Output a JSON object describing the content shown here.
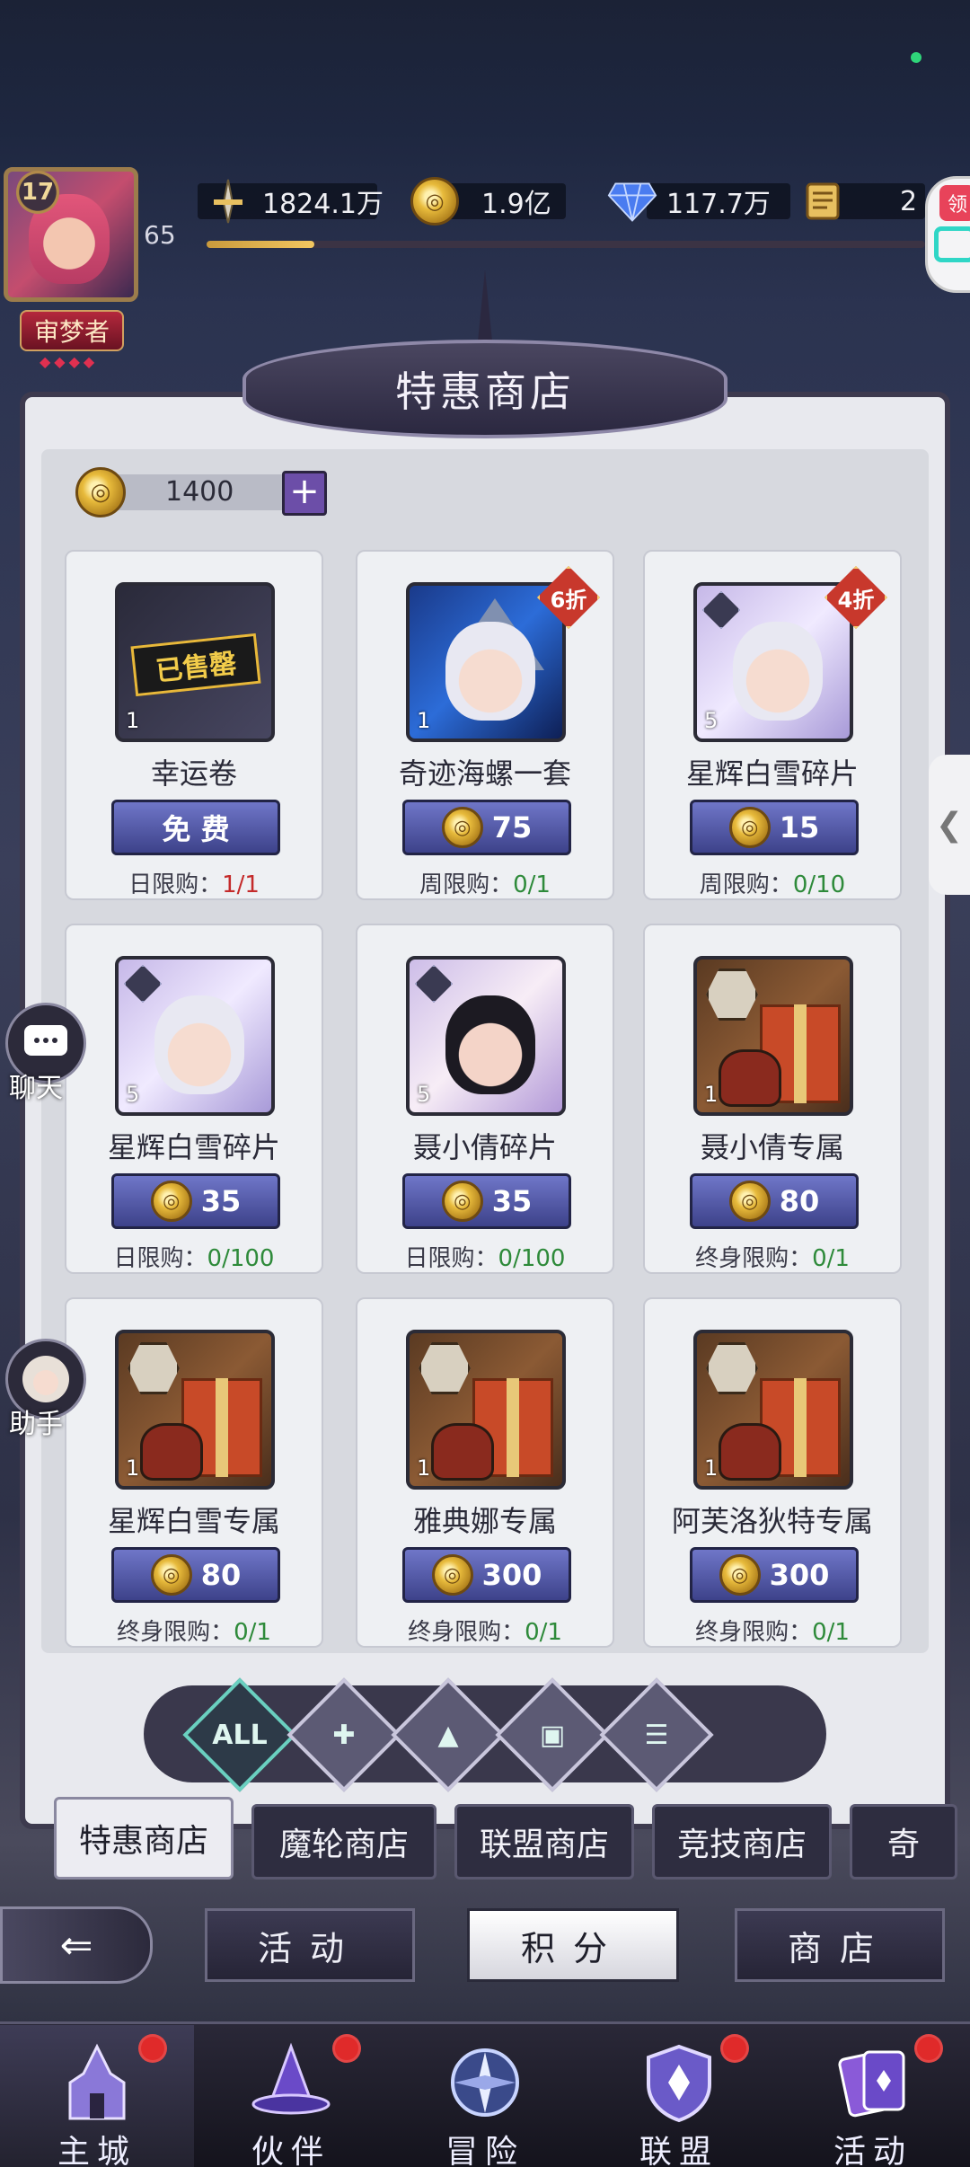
{
  "player": {
    "vip_level": "17",
    "level": "65",
    "title": "审梦者",
    "xp_fraction": 0.15
  },
  "resources": [
    {
      "name": "power",
      "icon": "sword-icon",
      "value": "1824.1万"
    },
    {
      "name": "gold",
      "icon": "gold-coin-icon",
      "value": "1.9亿"
    },
    {
      "name": "diamond",
      "icon": "diamond-icon",
      "value": "117.7万"
    },
    {
      "name": "scroll",
      "icon": "scroll-icon",
      "value": "2"
    }
  ],
  "gift_corner": {
    "tag": "领"
  },
  "shop": {
    "title": "特惠商店",
    "points": "1400",
    "add_label": "+",
    "items": [
      {
        "name": "幸运卷",
        "qty": "1",
        "stamp": "已售罄",
        "price": "免 费",
        "free": true,
        "limit_label": "日限购：",
        "limit_value": "1/1",
        "limit_color": "red",
        "discount": ""
      },
      {
        "name": "奇迹海螺一套",
        "qty": "1",
        "stamp": "",
        "price": "75",
        "free": false,
        "limit_label": "周限购：",
        "limit_value": "0/1",
        "limit_color": "green",
        "discount": "6折"
      },
      {
        "name": "星辉白雪碎片",
        "qty": "5",
        "stamp": "",
        "price": "15",
        "free": false,
        "limit_label": "周限购：",
        "limit_value": "0/10",
        "limit_color": "green",
        "discount": "4折"
      },
      {
        "name": "星辉白雪碎片",
        "qty": "5",
        "stamp": "",
        "price": "35",
        "free": false,
        "limit_label": "日限购：",
        "limit_value": "0/100",
        "limit_color": "green",
        "discount": ""
      },
      {
        "name": "聂小倩碎片",
        "qty": "5",
        "stamp": "",
        "price": "35",
        "free": false,
        "limit_label": "日限购：",
        "limit_value": "0/100",
        "limit_color": "green",
        "discount": ""
      },
      {
        "name": "聂小倩专属",
        "qty": "1",
        "stamp": "",
        "price": "80",
        "free": false,
        "limit_label": "终身限购：",
        "limit_value": "0/1",
        "limit_color": "green",
        "discount": ""
      },
      {
        "name": "星辉白雪专属",
        "qty": "1",
        "stamp": "",
        "price": "80",
        "free": false,
        "limit_label": "终身限购：",
        "limit_value": "0/1",
        "limit_color": "green",
        "discount": ""
      },
      {
        "name": "雅典娜专属",
        "qty": "1",
        "stamp": "",
        "price": "300",
        "free": false,
        "limit_label": "终身限购：",
        "limit_value": "0/1",
        "limit_color": "green",
        "discount": ""
      },
      {
        "name": "阿芙洛狄特专属",
        "qty": "1",
        "stamp": "",
        "price": "300",
        "free": false,
        "limit_label": "终身限购：",
        "limit_value": "0/1",
        "limit_color": "green",
        "discount": ""
      }
    ],
    "filters": [
      {
        "label": "ALL",
        "icon": "all-filter-icon",
        "active": true
      },
      {
        "label": "",
        "icon": "puzzle-filter-icon",
        "active": false
      },
      {
        "label": "",
        "icon": "hat-filter-icon",
        "active": false
      },
      {
        "label": "",
        "icon": "giftbox-filter-icon",
        "active": false
      },
      {
        "label": "",
        "icon": "list-filter-icon",
        "active": false
      }
    ],
    "tabs": [
      "特惠商店",
      "魔轮商店",
      "联盟商店",
      "竞技商店",
      "奇"
    ],
    "active_tab": 0
  },
  "sub_tabs": [
    "活动",
    "积分",
    "商店"
  ],
  "active_sub_tab": 1,
  "side": {
    "chat": "聊天",
    "helper": "助手"
  },
  "bottom_nav": [
    {
      "label": "主城",
      "icon": "castle-icon",
      "badge": true,
      "active": true
    },
    {
      "label": "伙伴",
      "icon": "witch-hat-icon",
      "badge": true,
      "active": false
    },
    {
      "label": "冒险",
      "icon": "compass-icon",
      "badge": false,
      "active": false
    },
    {
      "label": "联盟",
      "icon": "shield-icon",
      "badge": true,
      "active": false
    },
    {
      "label": "活动",
      "icon": "cards-icon",
      "badge": true,
      "active": false
    }
  ],
  "colors": {
    "accent": "#4a4fa0",
    "limit_red": "#c42a2a",
    "limit_green": "#2e8a3a"
  }
}
